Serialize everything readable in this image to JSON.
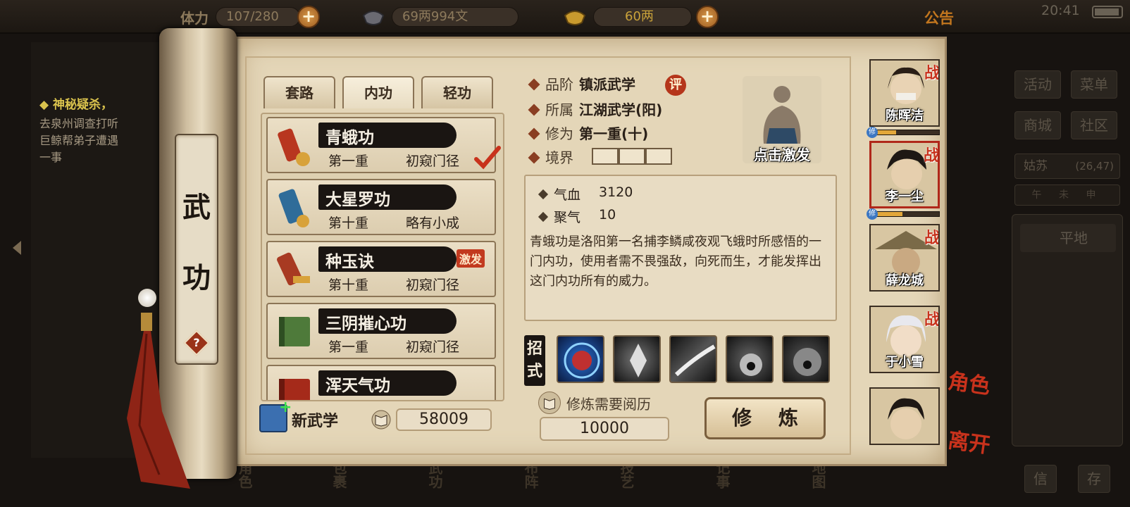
{
  "topbar": {
    "stamina_label": "体力",
    "stamina": "107/280",
    "silver": "69两994文",
    "gold": "60两",
    "announcement": "公告",
    "time": "20:41"
  },
  "quest": {
    "title": "◆ 神秘疑杀，",
    "desc_line1": "去泉州调查打听",
    "desc_line2": "巨鲸帮弟子遭遇",
    "desc_line3": "一事"
  },
  "scroll": {
    "char1": "武",
    "char2": "功",
    "help": "?"
  },
  "tabs": [
    {
      "label": "套路",
      "active": false
    },
    {
      "label": "内功",
      "active": true
    },
    {
      "label": "轻功",
      "active": false
    }
  ],
  "skills": [
    {
      "name": "青蛾功",
      "level": "第一重",
      "rank": "初窥门径",
      "checked": true,
      "icon": "red-scroll-icon"
    },
    {
      "name": "大星罗功",
      "level": "第十重",
      "rank": "略有小成",
      "icon": "blue-scroll-icon"
    },
    {
      "name": "种玉诀",
      "level": "第十重",
      "rank": "初窥门径",
      "badge": "激发",
      "icon": "red-scroll-icon"
    },
    {
      "name": "三阴摧心功",
      "level": "第一重",
      "rank": "初窥门径",
      "icon": "green-book-icon"
    },
    {
      "name": "浑天气功",
      "level": "",
      "rank": "",
      "icon": "red-book-icon"
    }
  ],
  "new_skill": {
    "label": "新武学",
    "xp": "58009"
  },
  "info": {
    "grade_key": "品阶",
    "grade_val": "镇派武学",
    "eval": "评",
    "belong_key": "所属",
    "belong_val": "江湖武学(阳)",
    "cult_key": "修为",
    "cult_val": "第一重(十)",
    "realm_key": "境界"
  },
  "activate_label": "点击激发",
  "stats": {
    "hp_key": "气血",
    "hp_val": "3120",
    "qi_key": "聚气",
    "qi_val": "10"
  },
  "description": "青蛾功是洛阳第一名捕李鳞咸夜观飞蛾时所感悟的一门内功，使用者需不畏强敌，向死而生，才能发挥出这门内功所有的威力。",
  "moves_label": "招式",
  "train": {
    "hint": "修炼需要阅历",
    "cost": "10000",
    "button": "修 炼"
  },
  "party": [
    {
      "name": "陈晖洁",
      "battle": "战",
      "xp": 0.35,
      "tag": "修"
    },
    {
      "name": "李一尘",
      "battle": "战",
      "xp": 0.45,
      "tag": "修"
    },
    {
      "name": "薛龙城",
      "battle": "战"
    },
    {
      "name": "于小雪",
      "battle": "战"
    },
    {
      "name": ""
    }
  ],
  "side": {
    "role": "角色",
    "leave": "离开"
  },
  "right_panel": {
    "activity": "活动",
    "menu": "菜单",
    "shop": "商城",
    "community": "社区",
    "location": "姑苏",
    "coords": "(26,47)",
    "time_of_day": "午 未 申",
    "terrain": "平地",
    "info_btn": "信",
    "save_btn": "存"
  },
  "bottom_nav": [
    "角色",
    "包裹",
    "武功",
    "布阵",
    "技艺",
    "记事",
    "地图"
  ],
  "colors": {
    "accent_red": "#c8321c",
    "parchment": "#e4d6b8",
    "ink": "#1a1512",
    "gold_text": "#d9c24d"
  }
}
